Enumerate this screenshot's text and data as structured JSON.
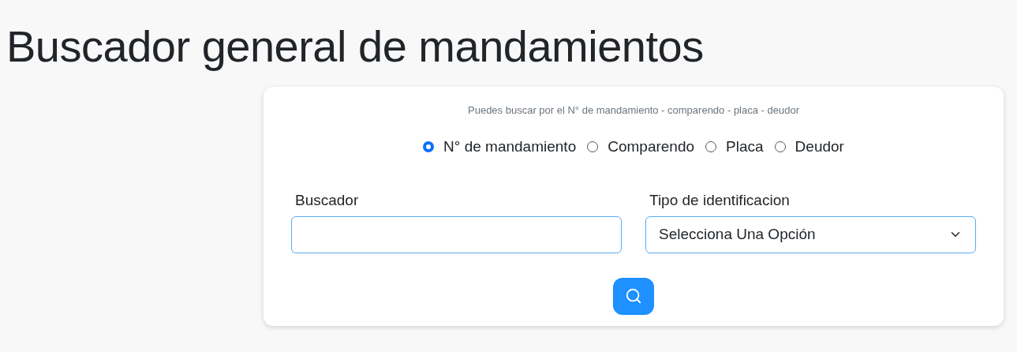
{
  "title": "Buscador general de mandamientos",
  "card": {
    "hint": "Puedes buscar por el N° de mandamiento - comparendo - placa - deudor",
    "options": [
      {
        "label": "N° de mandamiento",
        "selected": true
      },
      {
        "label": "Comparendo",
        "selected": false
      },
      {
        "label": "Placa",
        "selected": false
      },
      {
        "label": "Deudor",
        "selected": false
      }
    ],
    "search_label": "Buscador",
    "type_label": "Tipo de identificacion",
    "type_value": "Selecciona Una Opción"
  }
}
